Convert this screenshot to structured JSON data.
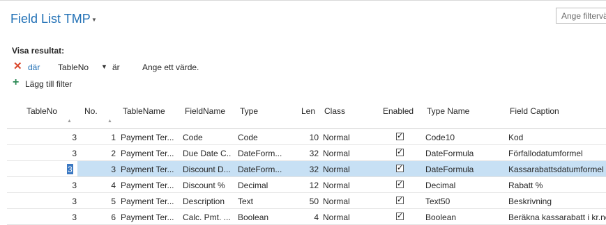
{
  "page": {
    "title": "Field List TMP",
    "filter_placeholder": "Ange filtervä"
  },
  "filters": {
    "section_label": "Visa resultat:",
    "where_label": "där",
    "field": "TableNo",
    "operator": "är",
    "value_hint": "Ange ett värde.",
    "add_filter_label": "Lägg till filter"
  },
  "columns": [
    {
      "label": "TableNo"
    },
    {
      "label": "No."
    },
    {
      "label": "TableName"
    },
    {
      "label": "FieldName"
    },
    {
      "label": "Type"
    },
    {
      "label": "Len"
    },
    {
      "label": "Class"
    },
    {
      "label": "Enabled"
    },
    {
      "label": "Type Name"
    },
    {
      "label": "Field Caption"
    }
  ],
  "rows": [
    {
      "table_no": "3",
      "no": "1",
      "table_name": "Payment Ter...",
      "field_name": "Code",
      "type": "Code",
      "len": "10",
      "class": "Normal",
      "enabled": true,
      "type_name": "Code10",
      "caption": "Kod"
    },
    {
      "table_no": "3",
      "no": "2",
      "table_name": "Payment Ter...",
      "field_name": "Due Date C...",
      "type": "DateForm...",
      "len": "32",
      "class": "Normal",
      "enabled": true,
      "type_name": "DateFormula",
      "caption": "Förfallodatumformel"
    },
    {
      "table_no": "3",
      "no": "3",
      "table_name": "Payment Ter...",
      "field_name": "Discount D...",
      "type": "DateForm...",
      "len": "32",
      "class": "Normal",
      "enabled": true,
      "type_name": "DateFormula",
      "caption": "Kassarabattsdatumformel",
      "selected": true
    },
    {
      "table_no": "3",
      "no": "4",
      "table_name": "Payment Ter...",
      "field_name": "Discount %",
      "type": "Decimal",
      "len": "12",
      "class": "Normal",
      "enabled": true,
      "type_name": "Decimal",
      "caption": "Rabatt %"
    },
    {
      "table_no": "3",
      "no": "5",
      "table_name": "Payment Ter...",
      "field_name": "Description",
      "type": "Text",
      "len": "50",
      "class": "Normal",
      "enabled": true,
      "type_name": "Text50",
      "caption": "Beskrivning"
    },
    {
      "table_no": "3",
      "no": "6",
      "table_name": "Payment Ter...",
      "field_name": "Calc. Pmt. ...",
      "type": "Boolean",
      "len": "4",
      "class": "Normal",
      "enabled": true,
      "type_name": "Boolean",
      "caption": "Beräkna kassarabatt i kr.no"
    }
  ],
  "icons": {
    "title_dropdown": "chevron-down-icon",
    "remove_filter": "close-icon",
    "field_dropdown": "chevron-down-icon",
    "add_filter": "plus-icon",
    "sort": "sort-arrow-up-icon",
    "enabled": "checkbox-checked-icon"
  },
  "colors": {
    "accent": "#1f6fb5",
    "remove": "#d9462a",
    "add": "#2e8b57",
    "selected_row": "#c7e0f4"
  }
}
